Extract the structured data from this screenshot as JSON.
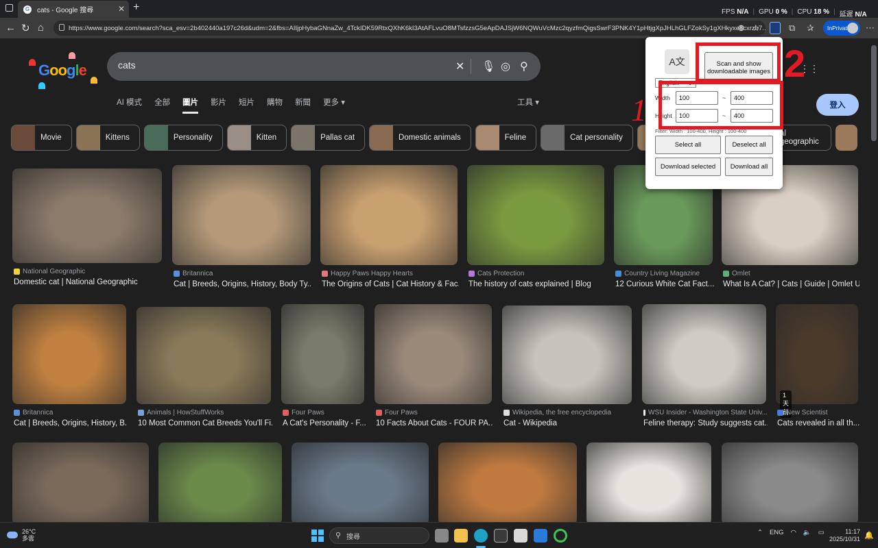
{
  "browser": {
    "tab_title": "cats - Google 搜尋",
    "url": "https://www.google.com/search?sca_esv=2b402440a197c26d&udm=2&fbs=AIIjpHybaGNnaZw_4TckIDK59RtxQXhK6kI3AtAFLvuO8MTsfzzsG5eApDAJSjW6NQWuVcMzc2qyzfmQigsSwrF3PNK4Y1pHtjgXpJHLhGLFZokSy1gXHkyxe8cxrzb7...",
    "inprivate_label": "InPrivate",
    "perf": [
      {
        "label": "FPS",
        "value": "N/A"
      },
      {
        "label": "GPU",
        "value": "0 %"
      },
      {
        "label": "CPU",
        "value": "18 %"
      },
      {
        "label": "延遲",
        "value": "N/A"
      }
    ]
  },
  "google": {
    "search_query": "cats",
    "signin_label": "登入",
    "nav_tabs": [
      "AI 模式",
      "全部",
      "圖片",
      "影片",
      "短片",
      "購物",
      "新聞",
      "更多 ▾"
    ],
    "active_tab": "圖片",
    "tools_label": "工具 ▾",
    "chips": [
      {
        "label": "Movie",
        "color": "#6b4a3a"
      },
      {
        "label": "Kittens",
        "color": "#8b7355"
      },
      {
        "label": "Personality",
        "color": "#4a6a5a"
      },
      {
        "label": "Kitten",
        "color": "#9a8f86"
      },
      {
        "label": "Pallas cat",
        "color": "#7a746a"
      },
      {
        "label": "Domestic animals",
        "color": "#8a6a50"
      },
      {
        "label": "Feline",
        "color": "#a88a70"
      },
      {
        "label": "Cat personality",
        "color": "#6a6a6a"
      },
      {
        "label": "Animal",
        "color": "#9a7a5a"
      }
    ],
    "chip_partial": "al geographic",
    "row1": [
      {
        "source": "National Geographic",
        "title": "Domestic cat | National Geographic",
        "icon_color": "#f4d03f",
        "img_color": "#8a7a6a"
      },
      {
        "source": "Britannica",
        "title": "Cat | Breeds, Origins, History, Body Ty...",
        "icon_color": "#5b8fd9",
        "img_color": "#b59a7a"
      },
      {
        "source": "Happy Paws Happy Hearts",
        "title": "The Origins of Cats | Cat History & Fac...",
        "icon_color": "#e07a7a",
        "img_color": "#c9a070"
      },
      {
        "source": "Cats Protection",
        "title": "The history of cats explained | Blog",
        "icon_color": "#b07ad9",
        "img_color": "#7a9a40"
      },
      {
        "source": "Country Living Magazine",
        "title": "12 Curious White Cat Fact...",
        "icon_color": "#4a8ad9",
        "img_color": "#6a9a5a"
      },
      {
        "source": "Omlet",
        "title": "What Is A Cat? | Cats | Guide | Omlet US",
        "icon_color": "#5ab07a",
        "img_color": "#d9cfc2"
      }
    ],
    "row2": [
      {
        "source": "Britannica",
        "title": "Cat | Breeds, Origins, History, B...",
        "icon_color": "#5b8fd9",
        "img_color": "#c08040"
      },
      {
        "source": "Animals | HowStuffWorks",
        "title": "10 Most Common Cat Breeds You'll Fi...",
        "icon_color": "#7aa0d9",
        "img_color": "#8a7a5a"
      },
      {
        "source": "Four Paws",
        "title": "A Cat's Personality - F...",
        "icon_color": "#e06060",
        "img_color": "#7a7a6a"
      },
      {
        "source": "Four Paws",
        "title": "10 Facts About Cats - FOUR PA...",
        "icon_color": "#e06060",
        "img_color": "#9a8a7a"
      },
      {
        "source": "Wikipedia, the free encyclopedia",
        "title": "Cat - Wikipedia",
        "icon_color": "#dddddd",
        "img_color": "#c8c4bc"
      },
      {
        "source": "WSU Insider - Washington State Univ...",
        "title": "Feline therapy: Study suggests cat...",
        "icon_color": "#eeeeee",
        "img_color": "#d0ccc4"
      },
      {
        "source": "New Scientist",
        "title": "Cats revealed in all th...",
        "icon_color": "#4a7ad9",
        "img_color": "#4a3a2a",
        "badge": "1 天前"
      }
    ],
    "row3_colors": [
      "#7a6a5a",
      "#6a8a4a",
      "#6a7a8a",
      "#c07a40",
      "#e8e4de",
      "#8a8a8a"
    ]
  },
  "extension": {
    "language": "English",
    "scan_button": "Scan and show downloadable images",
    "width_label": "Width",
    "height_label": "Height",
    "width_min": "100",
    "width_max": "400",
    "height_min": "100",
    "height_max": "400",
    "filter_text": "Filter: Width : 100-400, Height : 100-400",
    "select_all": "Select all",
    "deselect_all": "Deselect all",
    "download_selected": "Download selected",
    "download_all": "Download all"
  },
  "annotations": {
    "mark1": "1",
    "mark2": "2",
    "color": "#e01b24"
  },
  "taskbar": {
    "temperature": "26°C",
    "weather": "多雲",
    "search_placeholder": "搜尋",
    "lang": "ENG",
    "time": "11:17",
    "date": "2025/10/31"
  }
}
